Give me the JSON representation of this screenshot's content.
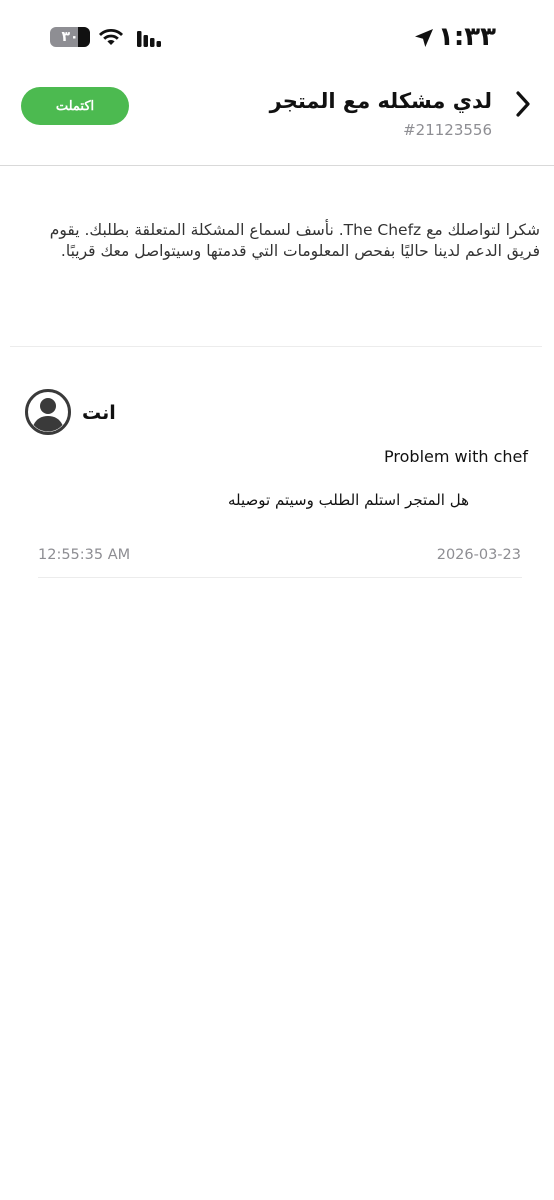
{
  "status_bar": {
    "time": "١:٣٣",
    "battery_level": "٣٠",
    "battery_fraction": 0.3,
    "icons": [
      "wifi-icon",
      "cellular-signal-icon",
      "location-arrow-icon"
    ]
  },
  "header": {
    "title": "لدي مشكله مع المتجر",
    "ticket_number": "#21123556",
    "status_label": "اكتملت",
    "status_color": "#4cba50"
  },
  "intro": {
    "text": "شكرا لتواصلك مع The Chefz. نأسف لسماع المشكلة المتعلقة بطلبك. يقوم فريق الدعم لدينا حاليًا بفحص المعلومات التي قدمتها وسيتواصل معك قريبًا."
  },
  "message": {
    "sender": "انت",
    "subject": "Problem with chef",
    "body": "هل المتجر استلم الطلب وسيتم توصيله",
    "time": "12:55:35 AM",
    "date": "2026-03-23"
  }
}
